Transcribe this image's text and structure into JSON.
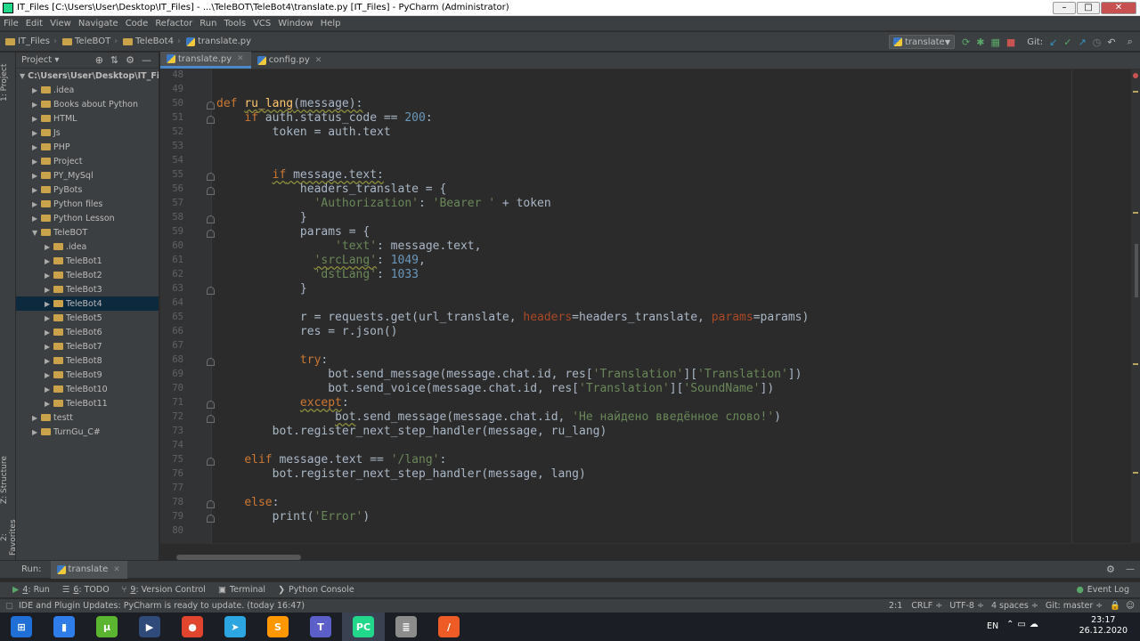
{
  "window": {
    "title": "IT_Files [C:\\Users\\User\\Desktop\\IT_Files] - ...\\TeleBOT\\TeleBot4\\translate.py [IT_Files] - PyCharm (Administrator)",
    "minimize": "–",
    "maximize": "□",
    "close": "✕"
  },
  "menu": [
    "File",
    "Edit",
    "View",
    "Navigate",
    "Code",
    "Refactor",
    "Run",
    "Tools",
    "VCS",
    "Window",
    "Help"
  ],
  "breadcrumbs": [
    "IT_Files",
    "TeleBOT",
    "TeleBot4",
    "translate.py"
  ],
  "run_config": "translate",
  "git_label": "Git:",
  "left_tabs": {
    "project": "1: Project",
    "structure": "Z: Structure",
    "favorites": "2: Favorites"
  },
  "project_panel": {
    "title": "Project",
    "root": "C:\\Users\\User\\Desktop\\IT_Fil",
    "items": [
      {
        "label": ".idea",
        "depth": 1,
        "expanded": false
      },
      {
        "label": "Books about Python",
        "depth": 1,
        "expanded": false
      },
      {
        "label": "HTML",
        "depth": 1,
        "expanded": false
      },
      {
        "label": "Js",
        "depth": 1,
        "expanded": false
      },
      {
        "label": "PHP",
        "depth": 1,
        "expanded": false
      },
      {
        "label": "Project",
        "depth": 1,
        "expanded": false
      },
      {
        "label": "PY_MySql",
        "depth": 1,
        "expanded": false
      },
      {
        "label": "PyBots",
        "depth": 1,
        "expanded": false
      },
      {
        "label": "Python files",
        "depth": 1,
        "expanded": false
      },
      {
        "label": "Python Lesson",
        "depth": 1,
        "expanded": false
      },
      {
        "label": "TeleBOT",
        "depth": 1,
        "expanded": true
      },
      {
        "label": ".idea",
        "depth": 2,
        "expanded": false
      },
      {
        "label": "TeleBot1",
        "depth": 2,
        "expanded": false
      },
      {
        "label": "TeleBot2",
        "depth": 2,
        "expanded": false
      },
      {
        "label": "TeleBot3",
        "depth": 2,
        "expanded": false
      },
      {
        "label": "TeleBot4",
        "depth": 2,
        "expanded": false,
        "selected": true
      },
      {
        "label": "TeleBot5",
        "depth": 2,
        "expanded": false
      },
      {
        "label": "TeleBot6",
        "depth": 2,
        "expanded": false
      },
      {
        "label": "TeleBot7",
        "depth": 2,
        "expanded": false
      },
      {
        "label": "TeleBot8",
        "depth": 2,
        "expanded": false
      },
      {
        "label": "TeleBot9",
        "depth": 2,
        "expanded": false
      },
      {
        "label": "TeleBot10",
        "depth": 2,
        "expanded": false
      },
      {
        "label": "TeleBot11",
        "depth": 2,
        "expanded": false
      },
      {
        "label": "testt",
        "depth": 1,
        "expanded": false
      },
      {
        "label": "TurnGu_C#",
        "depth": 1,
        "expanded": false
      }
    ]
  },
  "editor_tabs": [
    {
      "label": "translate.py",
      "active": true
    },
    {
      "label": "config.py",
      "active": false
    }
  ],
  "code": {
    "first_line": 48,
    "lines": [
      [],
      [],
      [
        {
          "t": "def ",
          "c": "kw"
        },
        {
          "t": "ru_lang",
          "c": "fn wavy"
        },
        {
          "t": "(message):",
          "c": "wavy"
        }
      ],
      [
        {
          "t": "    "
        },
        {
          "t": "if ",
          "c": "kw"
        },
        {
          "t": "auth.status_code == "
        },
        {
          "t": "200",
          "c": "num"
        },
        {
          "t": ":"
        }
      ],
      [
        {
          "t": "        token = auth.text"
        }
      ],
      [],
      [],
      [
        {
          "t": "        "
        },
        {
          "t": "if",
          "c": "kw wavy"
        },
        {
          "t": " message.text:",
          "c": "wavy"
        }
      ],
      [
        {
          "t": "            headers_translate = {"
        }
      ],
      [
        {
          "t": "              "
        },
        {
          "t": "'Authorization'",
          "c": "str"
        },
        {
          "t": ": "
        },
        {
          "t": "'Bearer '",
          "c": "str"
        },
        {
          "t": " + token"
        }
      ],
      [
        {
          "t": "            }"
        }
      ],
      [
        {
          "t": "            params = {"
        }
      ],
      [
        {
          "t": "                 "
        },
        {
          "t": "'text'",
          "c": "str"
        },
        {
          "t": ": message.text,"
        }
      ],
      [
        {
          "t": "              "
        },
        {
          "t": "'srcLang'",
          "c": "str wavy"
        },
        {
          "t": ": "
        },
        {
          "t": "1049",
          "c": "num"
        },
        {
          "t": ","
        }
      ],
      [
        {
          "t": "              "
        },
        {
          "t": "'dstLang'",
          "c": "str"
        },
        {
          "t": ": "
        },
        {
          "t": "1033",
          "c": "num"
        }
      ],
      [
        {
          "t": "            }"
        }
      ],
      [],
      [
        {
          "t": "            r = requests.get(url_translate, "
        },
        {
          "t": "headers",
          "c": "param"
        },
        {
          "t": "=headers_translate, "
        },
        {
          "t": "params",
          "c": "param"
        },
        {
          "t": "=params)"
        }
      ],
      [
        {
          "t": "            res = r.json()"
        }
      ],
      [],
      [
        {
          "t": "            "
        },
        {
          "t": "try",
          "c": "kw"
        },
        {
          "t": ":"
        }
      ],
      [
        {
          "t": "                bot.send_message(message.chat.id, res["
        },
        {
          "t": "'Translation'",
          "c": "str"
        },
        {
          "t": "]["
        },
        {
          "t": "'Translation'",
          "c": "str"
        },
        {
          "t": "])"
        }
      ],
      [
        {
          "t": "                bot.send_voice(message.chat.id, res["
        },
        {
          "t": "'Translation'",
          "c": "str"
        },
        {
          "t": "]["
        },
        {
          "t": "'SoundName'",
          "c": "str"
        },
        {
          "t": "])"
        }
      ],
      [
        {
          "t": "            "
        },
        {
          "t": "except",
          "c": "kw wavy"
        },
        {
          "t": ":"
        }
      ],
      [
        {
          "t": "                 "
        },
        {
          "t": "bot",
          "c": "wavy"
        },
        {
          "t": ".send_message(message.chat.id, "
        },
        {
          "t": "'Не найдено введённое слово!'",
          "c": "str"
        },
        {
          "t": ")"
        }
      ],
      [
        {
          "t": "        bot.register_next_step_handler(message, ru_lang)"
        }
      ],
      [],
      [
        {
          "t": "    "
        },
        {
          "t": "elif ",
          "c": "kw"
        },
        {
          "t": "message.text == "
        },
        {
          "t": "'/lang'",
          "c": "str"
        },
        {
          "t": ":"
        }
      ],
      [
        {
          "t": "        bot.register_next_step_handler(message, lang)"
        }
      ],
      [],
      [
        {
          "t": "    "
        },
        {
          "t": "else",
          "c": "kw"
        },
        {
          "t": ":"
        }
      ],
      [
        {
          "t": "        print("
        },
        {
          "t": "'Error'",
          "c": "str"
        },
        {
          "t": ")"
        }
      ],
      []
    ]
  },
  "run_panel": {
    "label": "Run:",
    "config": "translate"
  },
  "tool_windows": [
    {
      "num": "4",
      "label": ": Run",
      "icon": "play-icon"
    },
    {
      "num": "6",
      "label": ": TODO",
      "icon": "todo-icon"
    },
    {
      "num": "9",
      "label": ": Version Control",
      "icon": "vcs-icon"
    },
    {
      "num": "",
      "label": "Terminal",
      "icon": "terminal-icon"
    },
    {
      "num": "",
      "label": "Python Console",
      "icon": "python-console-icon"
    }
  ],
  "event_log": "Event Log",
  "status": {
    "message": "IDE and Plugin Updates: PyCharm is ready to update. (today 16:47)",
    "position": "2:1",
    "line_sep": "CRLF ÷",
    "encoding": "UTF-8 ÷",
    "indent": "4 spaces ÷",
    "git": "Git: master ÷"
  },
  "taskbar": {
    "apps": [
      {
        "name": "start",
        "color": "#1f6fd6",
        "glyph": "⊞"
      },
      {
        "name": "blue-app",
        "color": "#2e7de9",
        "glyph": "▮"
      },
      {
        "name": "utorrent",
        "color": "#5cb531",
        "glyph": "μ"
      },
      {
        "name": "media",
        "color": "#304a7a",
        "glyph": "▶"
      },
      {
        "name": "chrome",
        "color": "#e0452d",
        "glyph": "●"
      },
      {
        "name": "telegram",
        "color": "#2ca5e0",
        "glyph": "➤"
      },
      {
        "name": "sublime",
        "color": "#ff9800",
        "glyph": "S"
      },
      {
        "name": "teams",
        "color": "#5b5fc7",
        "glyph": "T"
      },
      {
        "name": "pycharm",
        "color": "#21d789",
        "glyph": "PC",
        "active": true
      },
      {
        "name": "database",
        "color": "#8c8c8c",
        "glyph": "≣"
      },
      {
        "name": "postman",
        "color": "#ef5b25",
        "glyph": "∕"
      }
    ],
    "lang": "EN",
    "time": "23:17",
    "date": "26.12.2020"
  }
}
